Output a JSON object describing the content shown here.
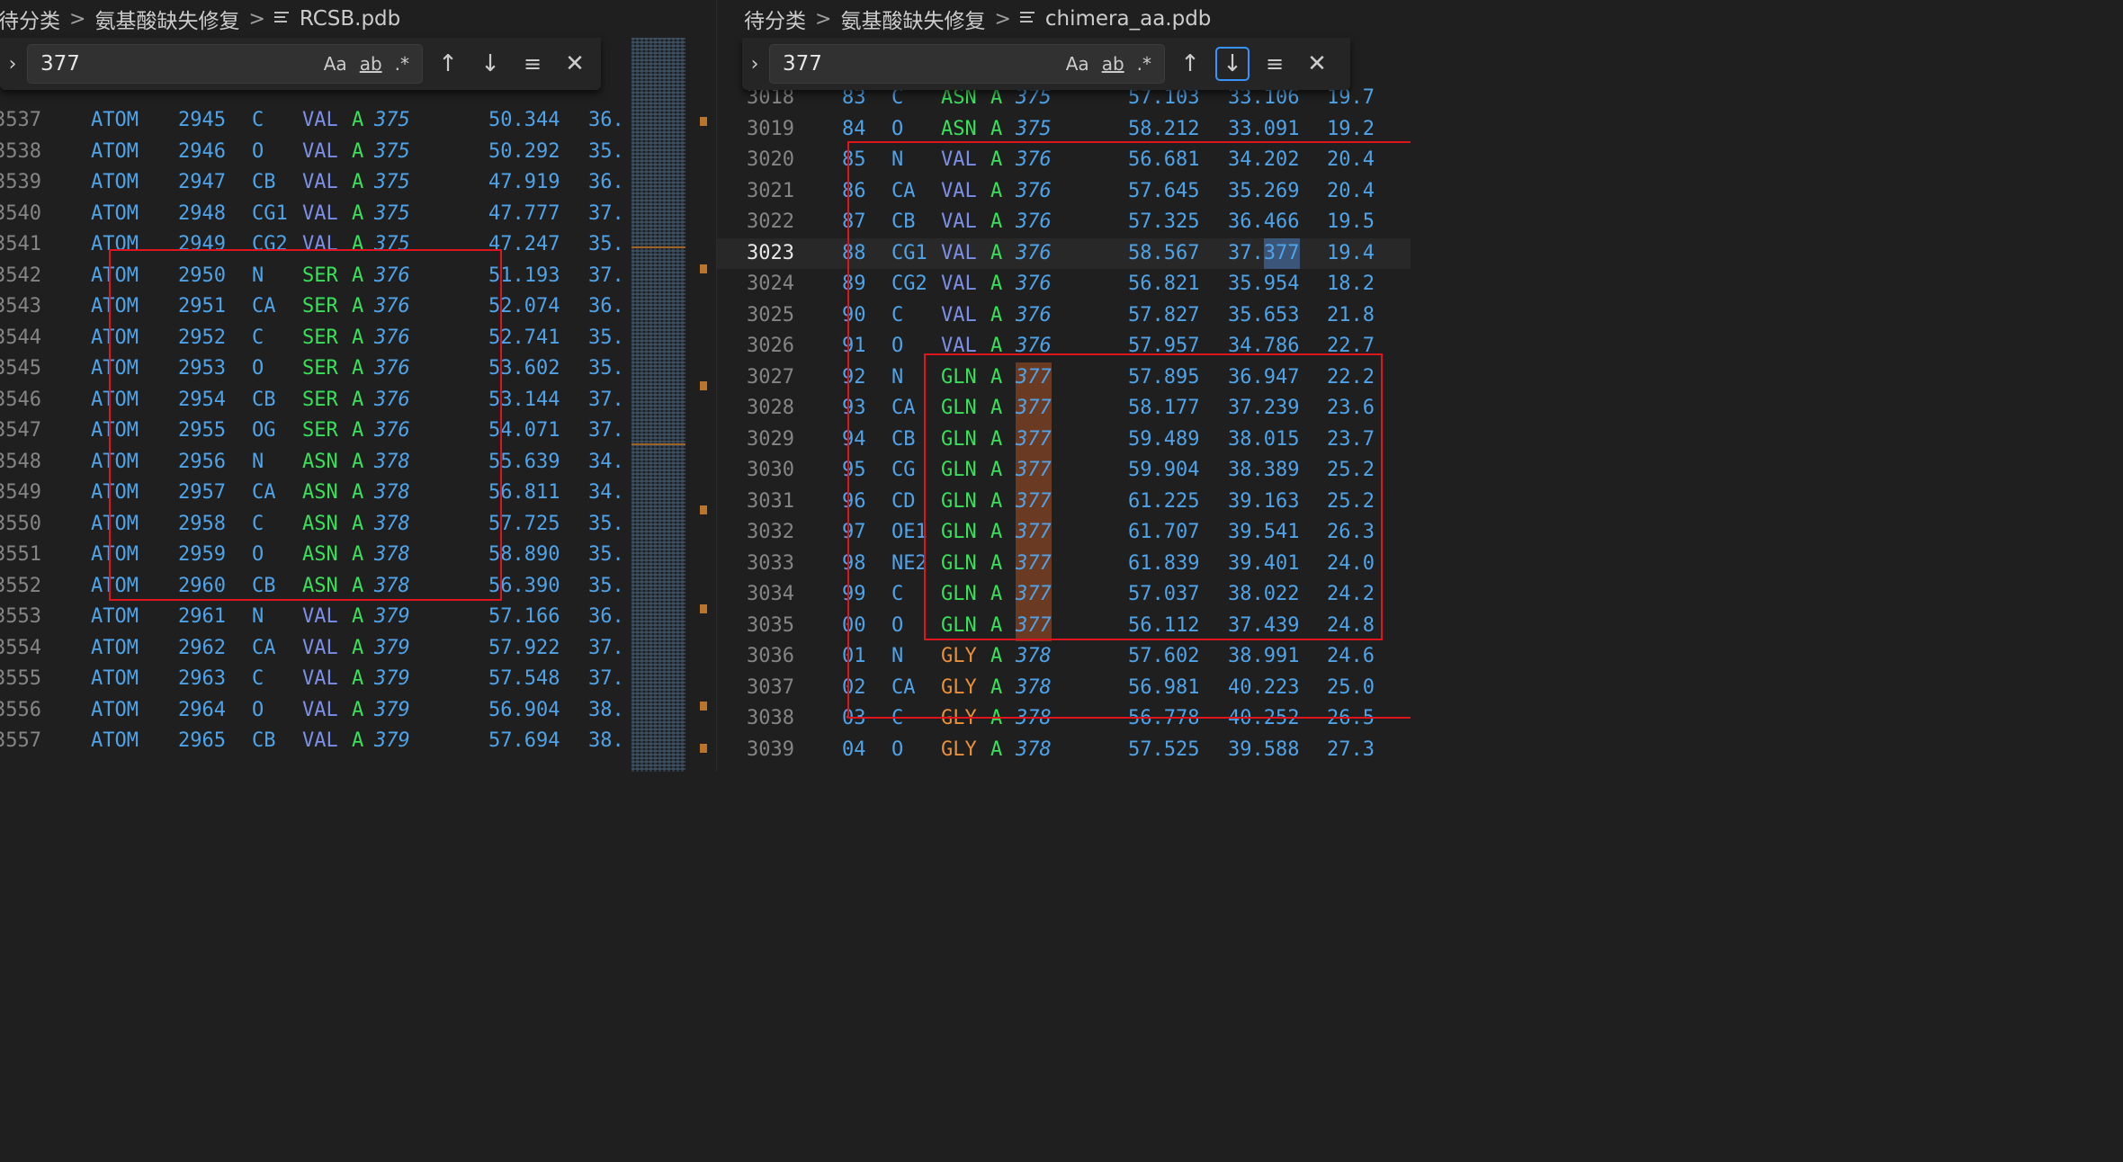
{
  "left": {
    "breadcrumb": {
      "folder": "待分类",
      "subfolder": "氨基酸缺失修复",
      "file": "RCSB.pdb"
    },
    "find": {
      "value": "377",
      "match_case": "Aa",
      "whole_word": "ab",
      "regex": ".*"
    },
    "lines": [
      [
        "3537",
        "ATOM",
        "2945",
        "C",
        "VAL",
        "A",
        "375",
        "50.344",
        "36."
      ],
      [
        "3538",
        "ATOM",
        "2946",
        "O",
        "VAL",
        "A",
        "375",
        "50.292",
        "35."
      ],
      [
        "3539",
        "ATOM",
        "2947",
        "CB",
        "VAL",
        "A",
        "375",
        "47.919",
        "36."
      ],
      [
        "3540",
        "ATOM",
        "2948",
        "CG1",
        "VAL",
        "A",
        "375",
        "47.777",
        "37."
      ],
      [
        "3541",
        "ATOM",
        "2949",
        "CG2",
        "VAL",
        "A",
        "375",
        "47.247",
        "35."
      ],
      [
        "3542",
        "ATOM",
        "2950",
        "N",
        "SER",
        "A",
        "376",
        "51.193",
        "37."
      ],
      [
        "3543",
        "ATOM",
        "2951",
        "CA",
        "SER",
        "A",
        "376",
        "52.074",
        "36."
      ],
      [
        "3544",
        "ATOM",
        "2952",
        "C",
        "SER",
        "A",
        "376",
        "52.741",
        "35."
      ],
      [
        "3545",
        "ATOM",
        "2953",
        "O",
        "SER",
        "A",
        "376",
        "53.602",
        "35."
      ],
      [
        "3546",
        "ATOM",
        "2954",
        "CB",
        "SER",
        "A",
        "376",
        "53.144",
        "37."
      ],
      [
        "3547",
        "ATOM",
        "2955",
        "OG",
        "SER",
        "A",
        "376",
        "54.071",
        "37."
      ],
      [
        "3548",
        "ATOM",
        "2956",
        "N",
        "ASN",
        "A",
        "378",
        "55.639",
        "34."
      ],
      [
        "3549",
        "ATOM",
        "2957",
        "CA",
        "ASN",
        "A",
        "378",
        "56.811",
        "34."
      ],
      [
        "3550",
        "ATOM",
        "2958",
        "C",
        "ASN",
        "A",
        "378",
        "57.725",
        "35."
      ],
      [
        "3551",
        "ATOM",
        "2959",
        "O",
        "ASN",
        "A",
        "378",
        "58.890",
        "35."
      ],
      [
        "3552",
        "ATOM",
        "2960",
        "CB",
        "ASN",
        "A",
        "378",
        "56.390",
        "35."
      ],
      [
        "3553",
        "ATOM",
        "2961",
        "N",
        "VAL",
        "A",
        "379",
        "57.166",
        "36."
      ],
      [
        "3554",
        "ATOM",
        "2962",
        "CA",
        "VAL",
        "A",
        "379",
        "57.922",
        "37."
      ],
      [
        "3555",
        "ATOM",
        "2963",
        "C",
        "VAL",
        "A",
        "379",
        "57.548",
        "37."
      ],
      [
        "3556",
        "ATOM",
        "2964",
        "O",
        "VAL",
        "A",
        "379",
        "56.904",
        "38."
      ],
      [
        "3557",
        "ATOM",
        "2965",
        "CB",
        "VAL",
        "A",
        "379",
        "57.694",
        "38."
      ]
    ]
  },
  "right": {
    "breadcrumb": {
      "folder": "待分类",
      "subfolder": "氨基酸缺失修复",
      "file": "chimera_aa.pdb"
    },
    "find": {
      "value": "377",
      "match_case": "Aa",
      "whole_word": "ab",
      "regex": ".*"
    },
    "lines": [
      [
        "3018",
        "83",
        "C",
        "ASN",
        "A",
        "375",
        "57.103",
        "33.106",
        "19.7"
      ],
      [
        "3019",
        "84",
        "O",
        "ASN",
        "A",
        "375",
        "58.212",
        "33.091",
        "19.2"
      ],
      [
        "3020",
        "85",
        "N",
        "VAL",
        "A",
        "376",
        "56.681",
        "34.202",
        "20.4"
      ],
      [
        "3021",
        "86",
        "CA",
        "VAL",
        "A",
        "376",
        "57.645",
        "35.269",
        "20.4"
      ],
      [
        "3022",
        "87",
        "CB",
        "VAL",
        "A",
        "376",
        "57.325",
        "36.466",
        "19.5"
      ],
      [
        "3023",
        "88",
        "CG1",
        "VAL",
        "A",
        "376",
        "58.567",
        "37.377",
        "19.4"
      ],
      [
        "3024",
        "89",
        "CG2",
        "VAL",
        "A",
        "376",
        "56.821",
        "35.954",
        "18.2"
      ],
      [
        "3025",
        "90",
        "C",
        "VAL",
        "A",
        "376",
        "57.827",
        "35.653",
        "21.8"
      ],
      [
        "3026",
        "91",
        "O",
        "VAL",
        "A",
        "376",
        "57.957",
        "34.786",
        "22.7"
      ],
      [
        "3027",
        "92",
        "N",
        "GLN",
        "A",
        "377",
        "57.895",
        "36.947",
        "22.2"
      ],
      [
        "3028",
        "93",
        "CA",
        "GLN",
        "A",
        "377",
        "58.177",
        "37.239",
        "23.6"
      ],
      [
        "3029",
        "94",
        "CB",
        "GLN",
        "A",
        "377",
        "59.489",
        "38.015",
        "23.7"
      ],
      [
        "3030",
        "95",
        "CG",
        "GLN",
        "A",
        "377",
        "59.904",
        "38.389",
        "25.2"
      ],
      [
        "3031",
        "96",
        "CD",
        "GLN",
        "A",
        "377",
        "61.225",
        "39.163",
        "25.2"
      ],
      [
        "3032",
        "97",
        "OE1",
        "GLN",
        "A",
        "377",
        "61.707",
        "39.541",
        "26.3"
      ],
      [
        "3033",
        "98",
        "NE2",
        "GLN",
        "A",
        "377",
        "61.839",
        "39.401",
        "24.0"
      ],
      [
        "3034",
        "99",
        "C",
        "GLN",
        "A",
        "377",
        "57.037",
        "38.022",
        "24.2"
      ],
      [
        "3035",
        "00",
        "O",
        "GLN",
        "A",
        "377",
        "56.112",
        "37.439",
        "24.8"
      ],
      [
        "3036",
        "01",
        "N",
        "GLY",
        "A",
        "378",
        "57.602",
        "38.991",
        "24.6"
      ],
      [
        "3037",
        "02",
        "CA",
        "GLY",
        "A",
        "378",
        "56.981",
        "40.223",
        "25.0"
      ],
      [
        "3038",
        "03",
        "C",
        "GLY",
        "A",
        "378",
        "56.778",
        "40.252",
        "26.5"
      ],
      [
        "3039",
        "04",
        "O",
        "GLY",
        "A",
        "378",
        "57.525",
        "39.588",
        "27.3"
      ]
    ],
    "active_line": "3023"
  }
}
